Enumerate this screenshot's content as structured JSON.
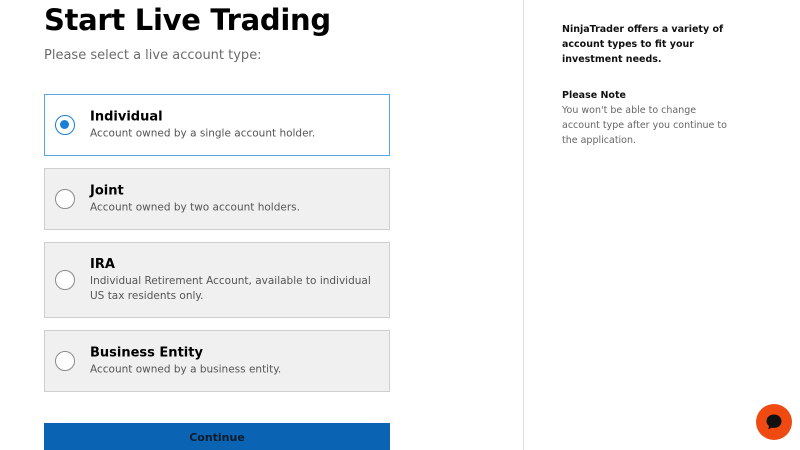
{
  "header": {
    "title": "Start Live Trading",
    "subtitle": "Please select a live account type:"
  },
  "account_types": [
    {
      "title": "Individual",
      "description": "Account owned by a single account holder.",
      "selected": true
    },
    {
      "title": "Joint",
      "description": "Account owned by two account holders.",
      "selected": false
    },
    {
      "title": "IRA",
      "description": "Individual Retirement Account, available to individual US tax residents only.",
      "selected": false
    },
    {
      "title": "Business Entity",
      "description": "Account owned by a business entity.",
      "selected": false
    }
  ],
  "continue_label": "Continue",
  "sidebar": {
    "intro": "NinjaTrader offers a variety of account types to fit your investment needs.",
    "note_title": "Please Note",
    "note_text": "You won't be able to change account type after you continue to the application."
  },
  "colors": {
    "accent": "#1a7fd6",
    "button": "#0b63b3",
    "chat": "#f04a13"
  },
  "icons": {
    "chat": "chat-bubble-icon"
  }
}
